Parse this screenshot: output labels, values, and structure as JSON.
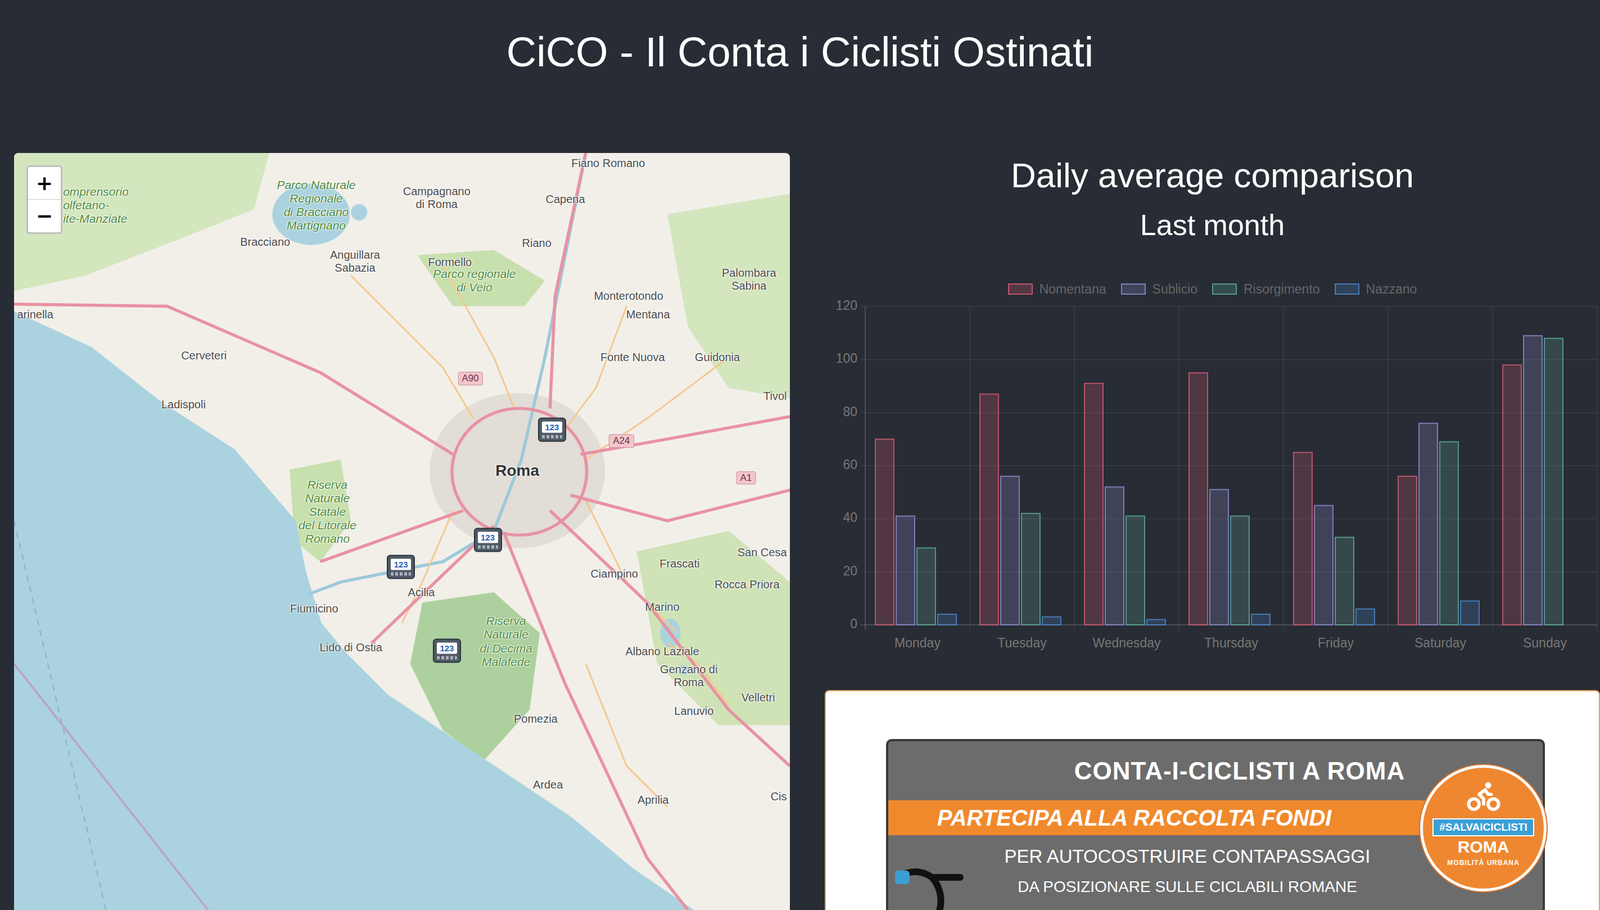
{
  "page": {
    "title": "CiCO - Il Conta i Ciclisti Ostinati"
  },
  "map": {
    "zoom_in": "+",
    "zoom_out": "−",
    "labels": [
      {
        "lines": [
          "omprensorio",
          "olfetano-",
          "ite-Manziate"
        ],
        "kind": "park"
      },
      {
        "lines": [
          "Parco Naturale",
          "Regionale",
          "di Bracciano",
          "Martignano"
        ],
        "kind": "park"
      },
      {
        "lines": [
          "Bracciano"
        ],
        "kind": "town"
      },
      {
        "lines": [
          "Campagnano",
          "di Roma"
        ],
        "kind": "town"
      },
      {
        "lines": [
          "Fiano Romano"
        ],
        "kind": "town"
      },
      {
        "lines": [
          "Capena"
        ],
        "kind": "town"
      },
      {
        "lines": [
          "Anguillara",
          "Sabazia"
        ],
        "kind": "town"
      },
      {
        "lines": [
          "Formello"
        ],
        "kind": "town"
      },
      {
        "lines": [
          "Parco regionale",
          "di Veio"
        ],
        "kind": "park"
      },
      {
        "lines": [
          "Riano"
        ],
        "kind": "town"
      },
      {
        "lines": [
          "Palombara",
          "Sabina"
        ],
        "kind": "town"
      },
      {
        "lines": [
          "Monterotondo"
        ],
        "kind": "town"
      },
      {
        "lines": [
          "Mentana"
        ],
        "kind": "town"
      },
      {
        "lines": [
          "arinella"
        ],
        "kind": "town"
      },
      {
        "lines": [
          "Cerveteri"
        ],
        "kind": "town"
      },
      {
        "lines": [
          "Fonte Nuova"
        ],
        "kind": "town"
      },
      {
        "lines": [
          "Guidonia"
        ],
        "kind": "town"
      },
      {
        "lines": [
          "Ladispoli"
        ],
        "kind": "town"
      },
      {
        "lines": [
          "Tivol"
        ],
        "kind": "town"
      },
      {
        "lines": [
          "A90"
        ],
        "kind": "road"
      },
      {
        "lines": [
          "A24"
        ],
        "kind": "road"
      },
      {
        "lines": [
          "A1"
        ],
        "kind": "road"
      },
      {
        "lines": [
          "Roma"
        ],
        "kind": "city"
      },
      {
        "lines": [
          "Riserva",
          "Naturale",
          "Statale",
          "del Litorale",
          "Romano"
        ],
        "kind": "park"
      },
      {
        "lines": [
          "San Cesa"
        ],
        "kind": "town"
      },
      {
        "lines": [
          "Frascati"
        ],
        "kind": "town"
      },
      {
        "lines": [
          "Ciampino"
        ],
        "kind": "town"
      },
      {
        "lines": [
          "Rocca Priora"
        ],
        "kind": "town"
      },
      {
        "lines": [
          "Acilia"
        ],
        "kind": "town"
      },
      {
        "lines": [
          "Fiumicino"
        ],
        "kind": "town"
      },
      {
        "lines": [
          "Marino"
        ],
        "kind": "town"
      },
      {
        "lines": [
          "Riserva",
          "Naturale",
          "di Decima",
          "Malafede"
        ],
        "kind": "park"
      },
      {
        "lines": [
          "Lido di Ostia"
        ],
        "kind": "town"
      },
      {
        "lines": [
          "Albano Laziale"
        ],
        "kind": "town"
      },
      {
        "lines": [
          "Genzano di",
          "Roma"
        ],
        "kind": "town"
      },
      {
        "lines": [
          "Velletri"
        ],
        "kind": "town"
      },
      {
        "lines": [
          "Lanuvio"
        ],
        "kind": "town"
      },
      {
        "lines": [
          "Pomezia"
        ],
        "kind": "town"
      },
      {
        "lines": [
          "Ardea"
        ],
        "kind": "town"
      },
      {
        "lines": [
          "Aprilia"
        ],
        "kind": "town"
      },
      {
        "lines": [
          "Cis"
        ],
        "kind": "town"
      }
    ],
    "counters": [
      {
        "label": "123"
      },
      {
        "label": "123"
      },
      {
        "label": "123"
      },
      {
        "label": "123"
      }
    ]
  },
  "chart": {
    "title": "Daily average comparison",
    "subtitle": "Last month",
    "y_ticks": [
      "0",
      "20",
      "40",
      "60",
      "80",
      "100",
      "120"
    ],
    "y_max": 120,
    "categories": [
      "Monday",
      "Tuesday",
      "Wednesday",
      "Thursday",
      "Friday",
      "Saturday",
      "Sunday"
    ],
    "series": [
      {
        "name": "Nomentana",
        "color": "#e0607a",
        "values": [
          70,
          87,
          91,
          95,
          65,
          56,
          98
        ]
      },
      {
        "name": "Sublicio",
        "color": "#9494dc",
        "values": [
          41,
          56,
          52,
          51,
          45,
          76,
          109
        ]
      },
      {
        "name": "Risorgimento",
        "color": "#62b3a4",
        "values": [
          29,
          42,
          41,
          41,
          33,
          69,
          108
        ]
      },
      {
        "name": "Nazzano",
        "color": "#4f8fd8",
        "values": [
          4,
          3,
          2,
          4,
          6,
          9,
          0
        ]
      }
    ]
  },
  "banner": {
    "title": "CONTA-I-CICLISTI A ROMA",
    "band": "PARTECIPA ALLA RACCOLTA FONDI",
    "line1": "PER  AUTOCOSTRUIRE CONTAPASSAGGI",
    "line2": "DA POSIZIONARE SULLE CICLABILI ROMANE",
    "badge": {
      "tag": "#SALVAICICLISTI",
      "city": "ROMA",
      "motto": "MOBILITÀ URBANA"
    }
  }
}
